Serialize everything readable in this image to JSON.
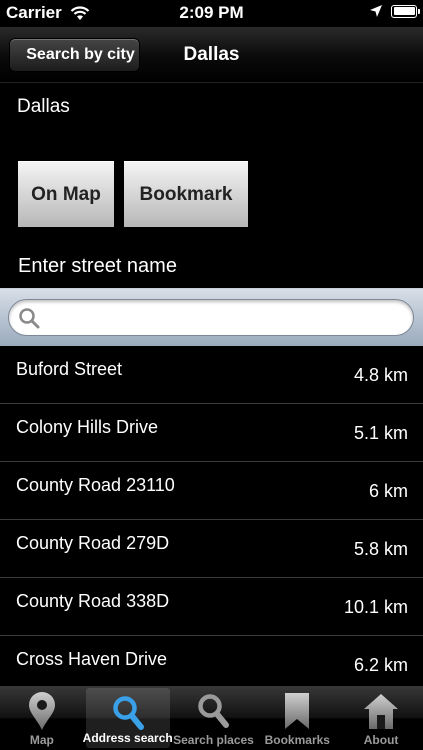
{
  "status_bar": {
    "carrier": "Carrier",
    "time": "2:09 PM"
  },
  "nav": {
    "back_label": "Search by city",
    "title": "Dallas"
  },
  "city_label": "Dallas",
  "buttons": {
    "on_map": "On Map",
    "bookmark": "Bookmark"
  },
  "street_prompt": "Enter street name",
  "search": {
    "value": "",
    "placeholder": ""
  },
  "streets": [
    {
      "name": "Buford Street",
      "distance": "4.8 km"
    },
    {
      "name": "Colony Hills Drive",
      "distance": "5.1 km"
    },
    {
      "name": "County Road 23110",
      "distance": "6 km"
    },
    {
      "name": "County Road 279D",
      "distance": "5.8 km"
    },
    {
      "name": "County Road 338D",
      "distance": "10.1 km"
    },
    {
      "name": "Cross Haven Drive",
      "distance": "6.2 km"
    }
  ],
  "tabs": [
    {
      "label": "Map",
      "icon": "map-pin-icon"
    },
    {
      "label": "Address search",
      "icon": "search-icon"
    },
    {
      "label": "Search places",
      "icon": "search-icon"
    },
    {
      "label": "Bookmarks",
      "icon": "bookmark-icon"
    },
    {
      "label": "About",
      "icon": "house-icon"
    }
  ],
  "active_tab": "Address search",
  "colors": {
    "active_blue": "#3aa0e8",
    "tab_gray": "#9a9a9a"
  }
}
